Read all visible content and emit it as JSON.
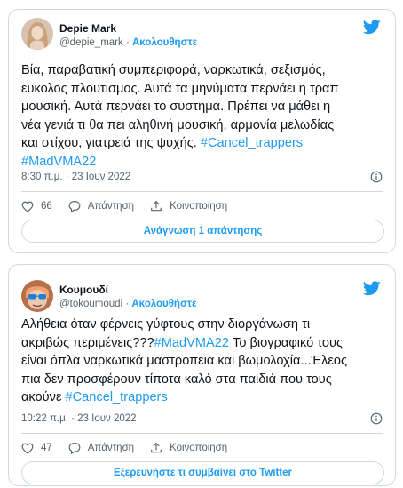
{
  "tweets": [
    {
      "name": "Depie Mark",
      "handle": "@depie_mark",
      "separator": " · ",
      "follow_label": "Ακολουθήστε",
      "text_lines": [
        [
          {
            "t": "Βία, παραβατική συμπεριφορά, ναρκωτικά, σεξισμός,"
          }
        ],
        [
          {
            "t": "ευκολος πλουτισμος. Αυτά τα μηνύματα περνάει η τραπ"
          }
        ],
        [
          {
            "t": "μουσική. Αυτά περνάει το συστημα. Πρέπει να μάθει η"
          }
        ],
        [
          {
            "t": "νέα γενιά τι θα πει αληθινή μουσική, αρμονία μελωδίας"
          }
        ],
        [
          {
            "t": "και στίχου, γιατρειά της ψυχής. "
          },
          {
            "t": "#Cancel_trappers",
            "tag": true
          }
        ],
        [
          {
            "t": "#MadVMA22",
            "tag": true
          }
        ]
      ],
      "timestamp": "8:30 π.μ. · 23 Ιουν 2022",
      "likes": "66",
      "reply_label": "Απάντηση",
      "share_label": "Κοινοποίηση",
      "button_label": "Ανάγνωση 1 απάντησης"
    },
    {
      "name": "Κουμουδί",
      "handle": "@tokoumoudi",
      "separator": " · ",
      "follow_label": "Ακολουθήστε",
      "text_lines": [
        [
          {
            "t": "Αλήθεια όταν φέρνεις γύφτους στην διοργάνωση τι"
          }
        ],
        [
          {
            "t": "ακριβώς περιμένεις???"
          },
          {
            "t": "#MadVMA22",
            "tag": true
          },
          {
            "t": " Το βιογραφικό τους"
          }
        ],
        [
          {
            "t": "είναι όπλα ναρκωτικά μαστροπεια και βωμολοχία...Έλεος"
          }
        ],
        [
          {
            "t": "πια δεν προσφέρουν τίποτα καλό στα παιδιά που τους"
          }
        ],
        [
          {
            "t": "ακούνε "
          },
          {
            "t": "#Cancel_trappers",
            "tag": true
          }
        ]
      ],
      "timestamp": "10:22 π.μ. · 23 Ιουν 2022",
      "likes": "47",
      "reply_label": "Απάντηση",
      "share_label": "Κοινοποίηση",
      "button_label": "Εξερευνήστε τι συμβαίνει στο Twitter"
    }
  ],
  "icons": {
    "brand": "twitter-bird-icon",
    "info": "info-icon",
    "like": "heart-icon",
    "reply": "reply-bubble-icon",
    "share": "share-upload-icon"
  },
  "colors": {
    "accent": "#1d9bf0",
    "text": "#0f1419",
    "muted": "#536471",
    "border": "#cfd9de"
  }
}
